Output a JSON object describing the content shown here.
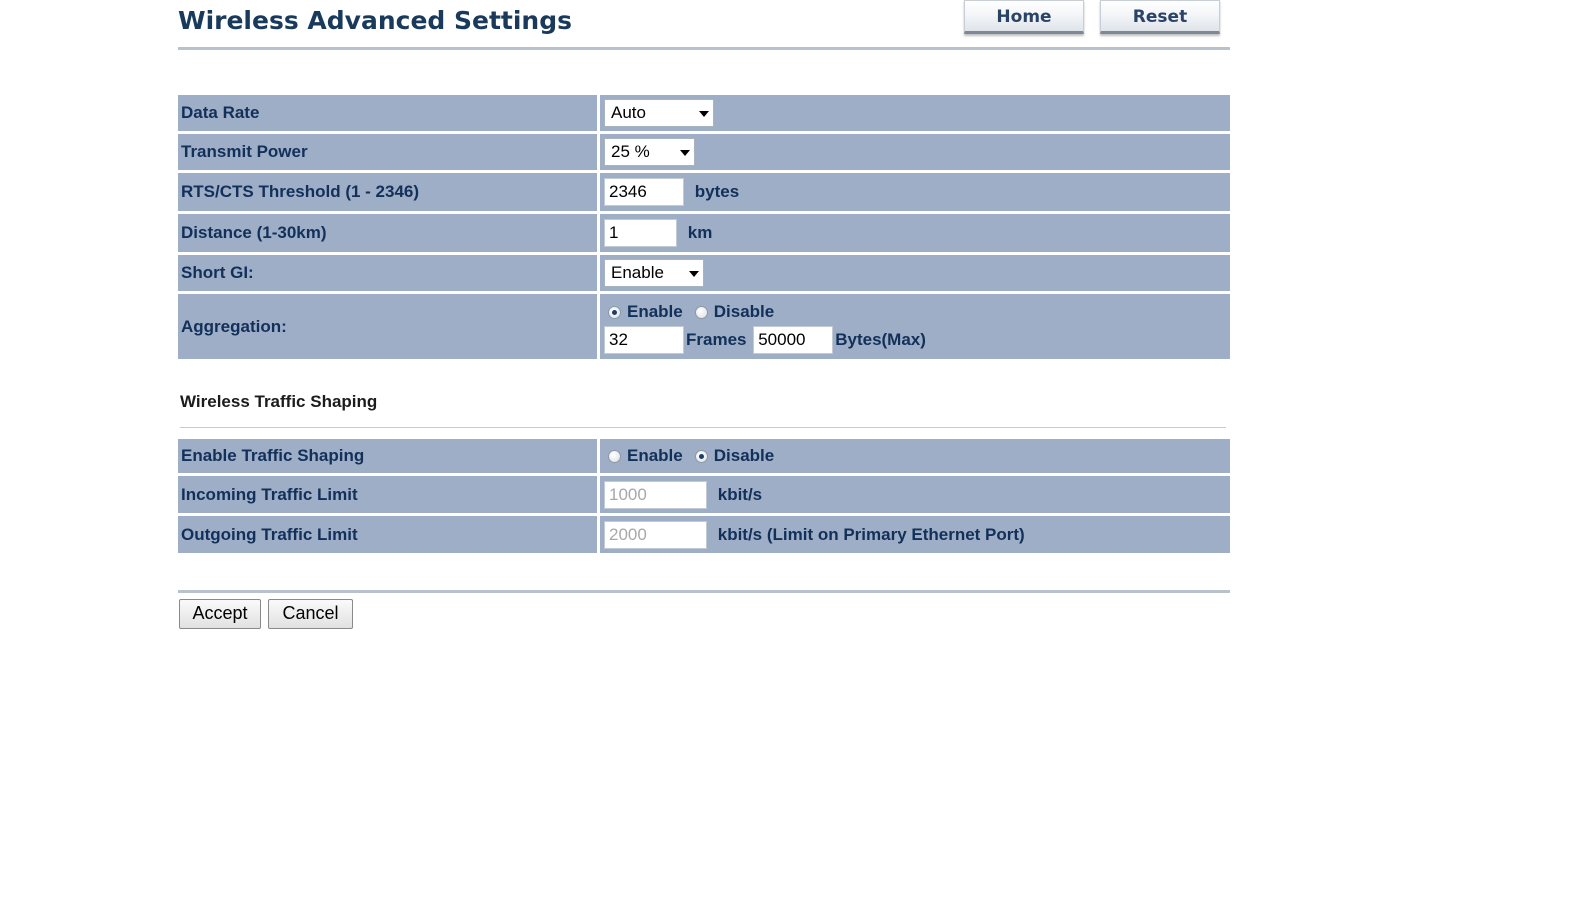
{
  "header": {
    "title": "Wireless Advanced Settings",
    "home_label": "Home",
    "reset_label": "Reset"
  },
  "advanced": {
    "data_rate": {
      "label": "Data Rate",
      "value": "Auto"
    },
    "transmit_power": {
      "label": "Transmit Power",
      "value": "25 %"
    },
    "rts_cts": {
      "label": "RTS/CTS Threshold (1 - 2346)",
      "value": "2346",
      "unit": "bytes"
    },
    "distance": {
      "label": "Distance (1-30km)",
      "value": "1",
      "unit": "km"
    },
    "short_gi": {
      "label": "Short GI:",
      "value": "Enable"
    },
    "aggregation": {
      "label": "Aggregation:",
      "enable_label": "Enable",
      "disable_label": "Disable",
      "selected": "Enable",
      "frames_value": "32",
      "frames_unit": "Frames",
      "bytes_value": "50000",
      "bytes_unit": "Bytes(Max)"
    }
  },
  "traffic": {
    "section_title": "Wireless Traffic Shaping",
    "enable_shaping": {
      "label": "Enable Traffic Shaping",
      "enable_label": "Enable",
      "disable_label": "Disable",
      "selected": "Disable"
    },
    "incoming": {
      "label": "Incoming Traffic Limit",
      "placeholder": "1000",
      "unit": "kbit/s"
    },
    "outgoing": {
      "label": "Outgoing Traffic Limit",
      "placeholder": "2000",
      "unit": "kbit/s (Limit on Primary Ethernet Port)"
    }
  },
  "actions": {
    "accept_label": "Accept",
    "cancel_label": "Cancel"
  },
  "colors": {
    "row_bg": "#9daec6",
    "label_text": "#13305a",
    "title_text": "#1a3a5c"
  }
}
